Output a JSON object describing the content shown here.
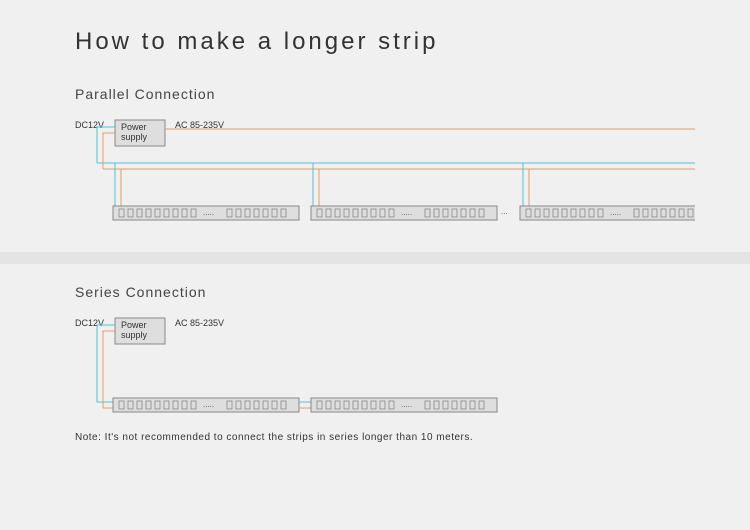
{
  "title": "How to make a longer strip",
  "parallel": {
    "heading": "Parallel Connection",
    "dc_label": "DC12V",
    "ac_label": "AC 85-235V",
    "psu": "Power supply"
  },
  "series": {
    "heading": "Series Connection",
    "dc_label": "DC12V",
    "ac_label": "AC 85-235V",
    "psu": "Power supply",
    "note": "Note: It's not recommended to connect the strips in series longer than 10 meters."
  }
}
